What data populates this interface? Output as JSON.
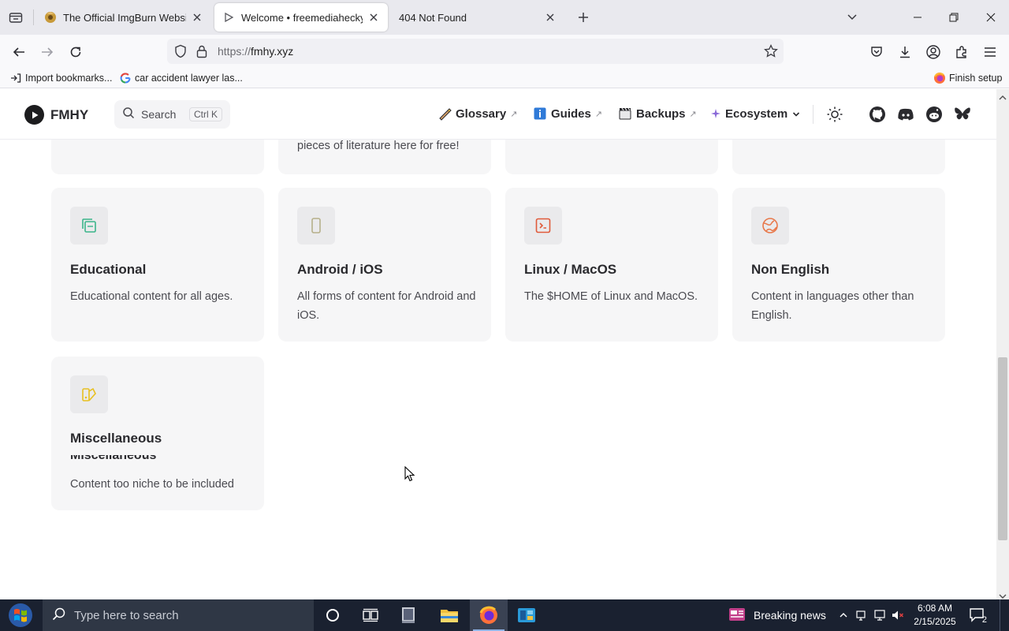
{
  "browser": {
    "tabs": [
      {
        "title": "The Official ImgBurn Website",
        "active": false
      },
      {
        "title": "Welcome • freemediaheckyeah",
        "active": true
      },
      {
        "title": "404 Not Found",
        "active": false
      }
    ],
    "url_scheme": "https://",
    "url_host": "fmhy.xyz",
    "bookmarks": [
      {
        "label": "Import bookmarks..."
      },
      {
        "label": "car accident lawyer las..."
      }
    ],
    "finish_setup": "Finish setup"
  },
  "site": {
    "logo_text": "FMHY",
    "search": {
      "label": "Search",
      "shortcut": "Ctrl K"
    },
    "nav": [
      {
        "label": "Glossary",
        "external": "↗"
      },
      {
        "label": "Guides",
        "external": "↗"
      },
      {
        "label": "Backups",
        "external": "↗"
      },
      {
        "label": "Ecosystem"
      }
    ]
  },
  "cards_partial": [
    {
      "desc": "pieces of literature here for free!"
    }
  ],
  "cards": [
    {
      "title": "Educational",
      "desc": "Educational content for all ages.",
      "icon": "books-icon",
      "icon_color": "#3bb58a"
    },
    {
      "title": "Android / iOS",
      "desc": "All forms of content for Android and iOS.",
      "icon": "phone-icon",
      "icon_color": "#b6b08a"
    },
    {
      "title": "Linux / MacOS",
      "desc": "The $HOME of Linux and MacOS.",
      "icon": "terminal-icon",
      "icon_color": "#e05a3a"
    },
    {
      "title": "Non English",
      "desc": "Content in languages other than English.",
      "icon": "globe-icon",
      "icon_color": "#e8784a"
    },
    {
      "title": "Miscellaneous",
      "title_ghost": "Miscellaneous",
      "desc": "Content too niche to be included",
      "icon": "shapes-icon",
      "icon_color": "#e8c020"
    }
  ],
  "taskbar": {
    "search_placeholder": "Type here to search",
    "news": "Breaking news",
    "time": "6:08 AM",
    "date": "2/15/2025",
    "notifications": "2"
  }
}
